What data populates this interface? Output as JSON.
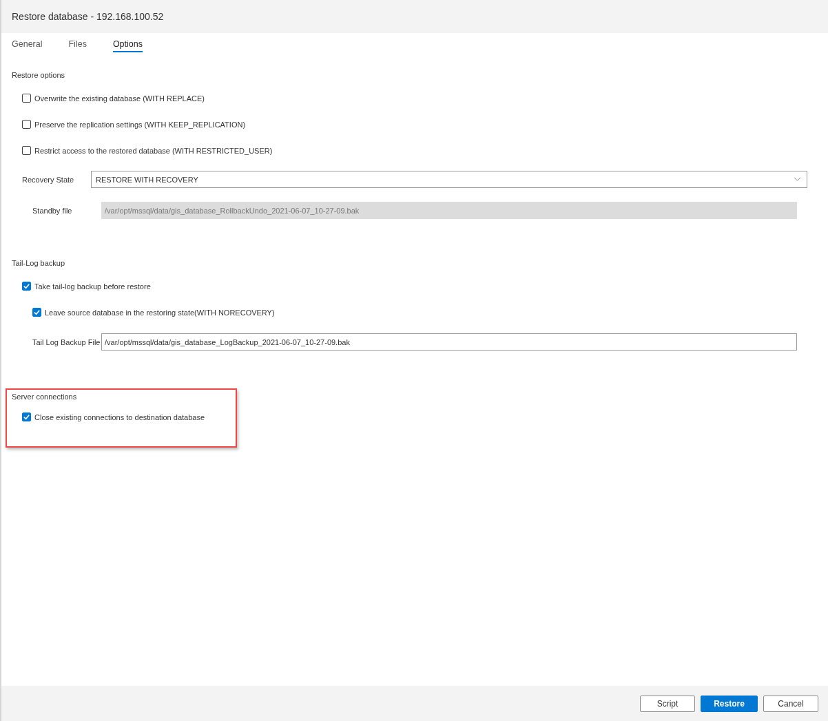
{
  "window": {
    "title": "Restore database - 192.168.100.52"
  },
  "tabs": [
    {
      "label": "General",
      "selected": false
    },
    {
      "label": "Files",
      "selected": false
    },
    {
      "label": "Options",
      "selected": true
    }
  ],
  "restore_options": {
    "heading": "Restore options",
    "checkboxes": [
      {
        "label": "Overwrite the existing database (WITH REPLACE)",
        "checked": false
      },
      {
        "label": "Preserve the replication settings (WITH KEEP_REPLICATION)",
        "checked": false
      },
      {
        "label": "Restrict access to the restored database (WITH RESTRICTED_USER)",
        "checked": false
      }
    ],
    "recovery_state": {
      "label": "Recovery State",
      "value": "RESTORE WITH RECOVERY"
    },
    "standby_file": {
      "label": "Standby file",
      "value": "/var/opt/mssql/data/gis_database_RollbackUndo_2021-06-07_10-27-09.bak",
      "disabled": true
    }
  },
  "tail_log_backup": {
    "heading": "Tail-Log backup",
    "checkboxes": [
      {
        "label": "Take tail-log backup before restore",
        "checked": true,
        "children": [
          {
            "label": "Leave source database in the restoring state(WITH NORECOVERY)",
            "checked": true
          }
        ]
      }
    ],
    "backup_file": {
      "label": "Tail Log Backup File",
      "value": "/var/opt/mssql/data/gis_database_LogBackup_2021-06-07_10-27-09.bak",
      "disabled": false
    }
  },
  "server_connections": {
    "heading": "Server connections",
    "highlighted": true,
    "checkboxes": [
      {
        "label": "Close existing connections to destination database",
        "checked": true
      }
    ]
  },
  "buttons": [
    {
      "label": "Script",
      "primary": false
    },
    {
      "label": "Restore",
      "primary": true
    },
    {
      "label": "Cancel",
      "primary": false
    }
  ]
}
